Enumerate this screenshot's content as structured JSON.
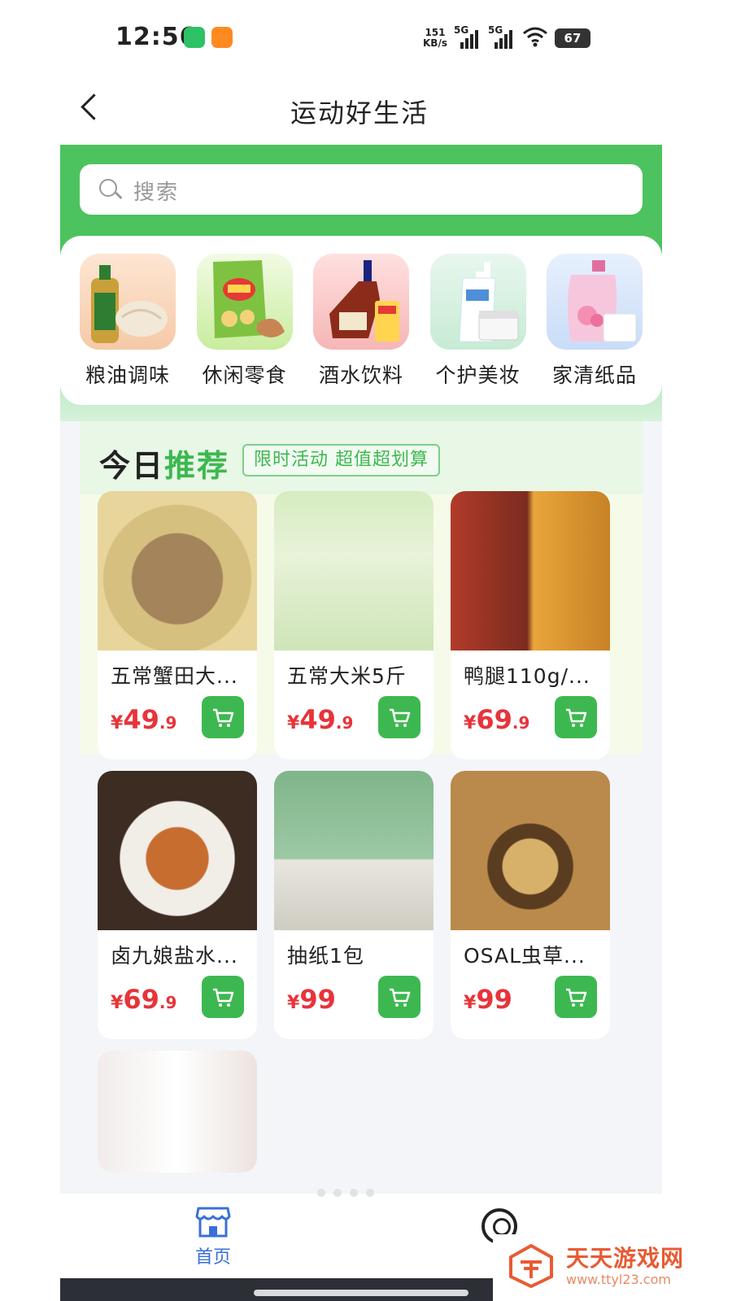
{
  "status_bar": {
    "time": "12:56",
    "net_speed_value": "151",
    "net_speed_unit": "KB/s",
    "signal1": "5G",
    "signal2": "5G",
    "battery": "67"
  },
  "nav": {
    "title": "运动好生活"
  },
  "search": {
    "placeholder": "搜索"
  },
  "categories": [
    {
      "label": "粮油调味",
      "icon": "oil-rice-icon"
    },
    {
      "label": "休闲零食",
      "icon": "snacks-icon"
    },
    {
      "label": "酒水饮料",
      "icon": "drinks-icon"
    },
    {
      "label": "个护美妆",
      "icon": "skincare-icon"
    },
    {
      "label": "家清纸品",
      "icon": "household-icon"
    }
  ],
  "recommend": {
    "title_a": "今日",
    "title_b": "推荐",
    "tag": "限时活动 超值超划算"
  },
  "products": [
    {
      "name": "五常蟹田大...",
      "currency": "¥",
      "int": "49",
      "dec": ".9"
    },
    {
      "name": "五常大米5斤",
      "currency": "¥",
      "int": "49",
      "dec": ".9"
    },
    {
      "name": "鸭腿110g/...",
      "currency": "¥",
      "int": "69",
      "dec": ".9"
    },
    {
      "name": "卤九娘盐水...",
      "currency": "¥",
      "int": "69",
      "dec": ".9"
    },
    {
      "name": "抽纸1包",
      "currency": "¥",
      "int": "99",
      "dec": ""
    },
    {
      "name": "OSAL虫草...",
      "currency": "¥",
      "int": "99",
      "dec": ""
    }
  ],
  "tabbar": {
    "home_label": "首页"
  },
  "watermark": {
    "name": "天天游戏网",
    "url": "www.ttyl23.com"
  },
  "colors": {
    "brand_green": "#3db850",
    "price_red": "#e8333a",
    "tab_active": "#3a6fd8"
  }
}
